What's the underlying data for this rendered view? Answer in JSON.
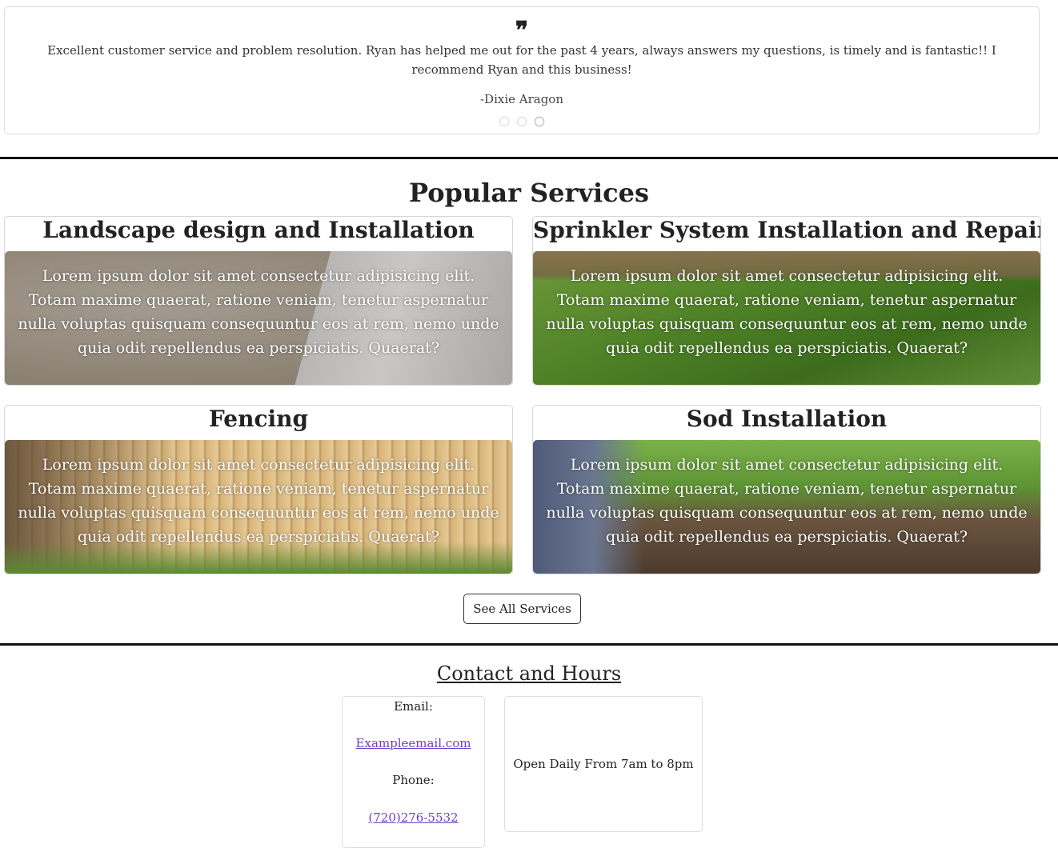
{
  "testimonial": {
    "quote_icon": "❞",
    "text": "Excellent customer service and problem resolution. Ryan has helped me out for the past 4 years, always answers my questions, is timely and is fantastic!! I recommend Ryan and this business!",
    "author": "-Dixie Aragon",
    "dots": 3,
    "active_dot": 3
  },
  "services": {
    "title": "Popular Services",
    "cards": [
      {
        "title": "Landscape design and Installation",
        "text": "Lorem ipsum dolor sit amet consectetur adipisicing elit. Totam maxime quaerat, ratione veniam, tenetur aspernatur nulla voluptas quisquam consequuntur eos at rem, nemo unde quia odit repellendus ea perspiciatis. Quaerat?"
      },
      {
        "title": "Sprinkler System Installation and Repair",
        "text": "Lorem ipsum dolor sit amet consectetur adipisicing elit. Totam maxime quaerat, ratione veniam, tenetur aspernatur nulla voluptas quisquam consequuntur eos at rem, nemo unde quia odit repellendus ea perspiciatis. Quaerat?"
      },
      {
        "title": "Fencing",
        "text": "Lorem ipsum dolor sit amet consectetur adipisicing elit. Totam maxime quaerat, ratione veniam, tenetur aspernatur nulla voluptas quisquam consequuntur eos at rem, nemo unde quia odit repellendus ea perspiciatis. Quaerat?"
      },
      {
        "title": "Sod Installation",
        "text": "Lorem ipsum dolor sit amet consectetur adipisicing elit. Totam maxime quaerat, ratione veniam, tenetur aspernatur nulla voluptas quisquam consequuntur eos at rem, nemo unde quia odit repellendus ea perspiciatis. Quaerat?"
      }
    ],
    "button_label": "See All Services"
  },
  "contact": {
    "title": "Contact and Hours",
    "email_label": "Email:",
    "email": "Exampleemail.com",
    "phone_label": "Phone:",
    "phone": "(720)276-5532",
    "hours": "Open Daily From 7am to 8pm"
  },
  "colors": {
    "link": "#6a3fc4",
    "divider": "#111111"
  }
}
